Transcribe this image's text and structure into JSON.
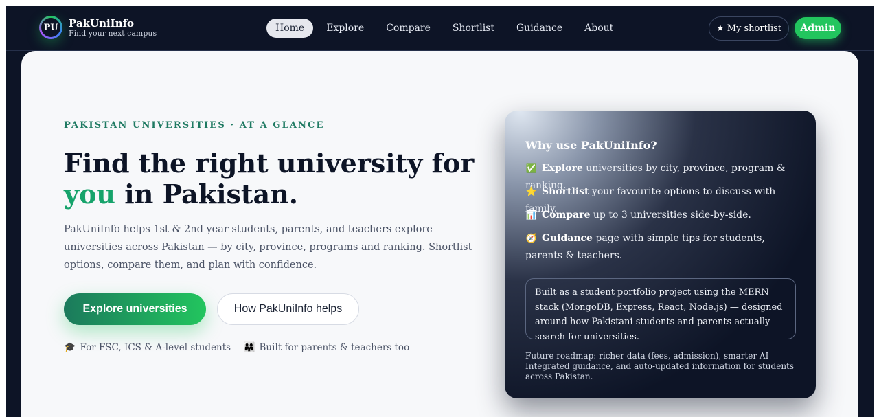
{
  "nav": {
    "logo_initials": "PU",
    "brand_name": "PakUniInfo",
    "brand_tagline": "Find your next campus",
    "links": [
      {
        "label": "Home",
        "active": true
      },
      {
        "label": "Explore",
        "active": false
      },
      {
        "label": "Compare",
        "active": false
      },
      {
        "label": "Shortlist",
        "active": false
      },
      {
        "label": "Guidance",
        "active": false
      },
      {
        "label": "About",
        "active": false
      }
    ],
    "shortlist_button": "★ My shortlist",
    "admin_button": "Admin"
  },
  "hero": {
    "eyebrow": "PAKISTAN UNIVERSITIES · AT A GLANCE",
    "headline_part1": "Find the right university for ",
    "headline_accent": "you",
    "headline_part2": " in Pakistan.",
    "lead": "PakUniInfo helps 1st & 2nd year students, parents, and teachers explore universities across Pakistan — by city, province, programs and ranking. Shortlist options, compare them, and plan with confidence.",
    "primary_cta": "Explore universities",
    "secondary_cta": "How PakUniInfo helps",
    "chips": [
      {
        "icon": "🎓",
        "icon_name": "graduation-cap-icon",
        "label": "For FSC, ICS & A-level students"
      },
      {
        "icon": "👨‍👩‍👧",
        "icon_name": "family-icon",
        "label": "Built for parents & teachers too"
      }
    ]
  },
  "panel": {
    "title": "Why use PakUniInfo?",
    "features": [
      {
        "icon": "✅",
        "icon_name": "check-icon",
        "bold": "Explore",
        "text": " universities by city, province, program & ranking."
      },
      {
        "icon": "⭐",
        "icon_name": "star-icon",
        "bold": "Shortlist",
        "text": " your favourite options to discuss with family."
      },
      {
        "icon": "📊",
        "icon_name": "bar-chart-icon",
        "bold": "Compare",
        "text": " up to 3 universities side-by-side."
      },
      {
        "icon": "🧭",
        "icon_name": "compass-icon",
        "bold": "Guidance",
        "text": " page with simple tips for students, parents & teachers."
      }
    ],
    "note": "Built as a student portfolio project using the MERN stack (MongoDB, Express, React, Node.js) — designed around how Pakistani students and parents actually search for universities.",
    "roadmap": "Future roadmap: richer data (fees, admission), smarter AI Integrated guidance, and auto-updated information for students across Pakistan."
  }
}
